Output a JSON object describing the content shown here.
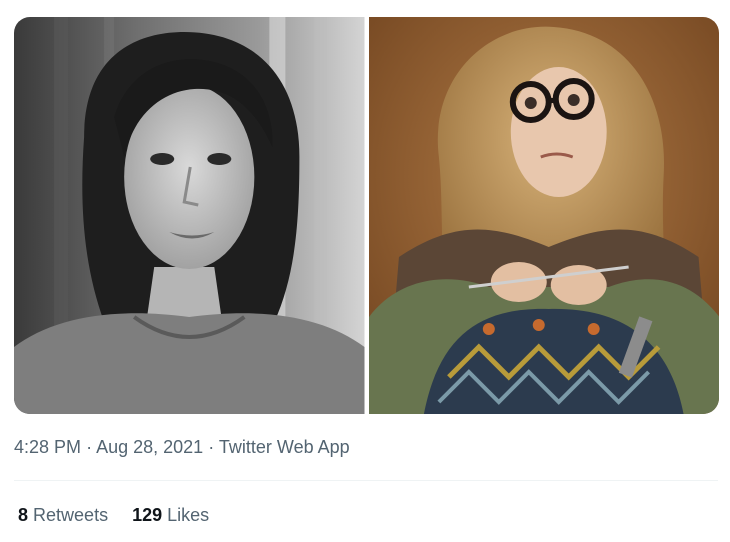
{
  "tweet": {
    "media": [
      {
        "description": "Black and white portrait of a woman with shoulder-length dark hair"
      },
      {
        "description": "Color photo of a woman with long curly blonde hair and large round glasses, knitting"
      }
    ],
    "meta": {
      "time": "4:28 PM",
      "separator": "·",
      "date": "Aug 28, 2021",
      "source": "Twitter Web App"
    },
    "stats": {
      "retweets_count": "8",
      "retweets_label": "Retweets",
      "likes_count": "129",
      "likes_label": "Likes"
    }
  },
  "colors": {
    "text_primary": "#0f1419",
    "text_secondary": "#536471",
    "divider": "#eff3f4"
  }
}
